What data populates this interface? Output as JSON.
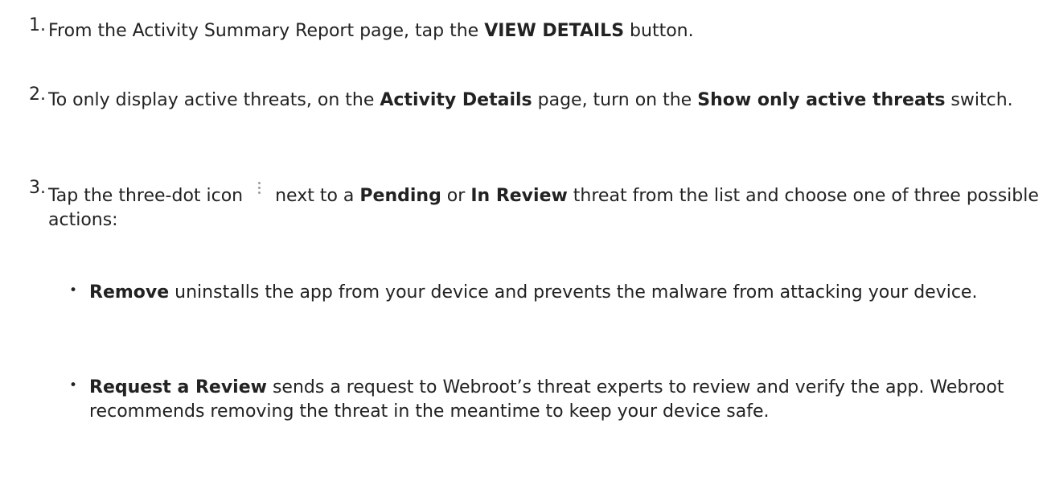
{
  "steps": [
    {
      "number": "1.",
      "t1": "From the Activity Summary Report page, tap the ",
      "b1": "VIEW DETAILS",
      "t2": " button."
    },
    {
      "number": "2.",
      "t1": "To only display active threats, on the ",
      "b1": "Activity Details",
      "t2": " page, turn on the ",
      "b2": "Show only active threats",
      "t3": " switch."
    },
    {
      "number": "3.",
      "t1": "Tap the three-dot icon ",
      "t2": " next to a ",
      "b1": "Pending",
      "t3": " or ",
      "b2": "In Review",
      "t4": " threat from the list and choose one of three possible actions:"
    }
  ],
  "actions": [
    {
      "bullet": "•",
      "name": "Remove",
      "text": " uninstalls the app from your device and prevents the malware from attacking your device."
    },
    {
      "bullet": "•",
      "name": "Request a Review",
      "text": " sends a request to Webroot’s threat experts to review and verify the app. Webroot recommends removing the threat in the meantime to keep your device safe."
    }
  ],
  "icons": {
    "three_dot": "three-dot-vertical-icon"
  }
}
